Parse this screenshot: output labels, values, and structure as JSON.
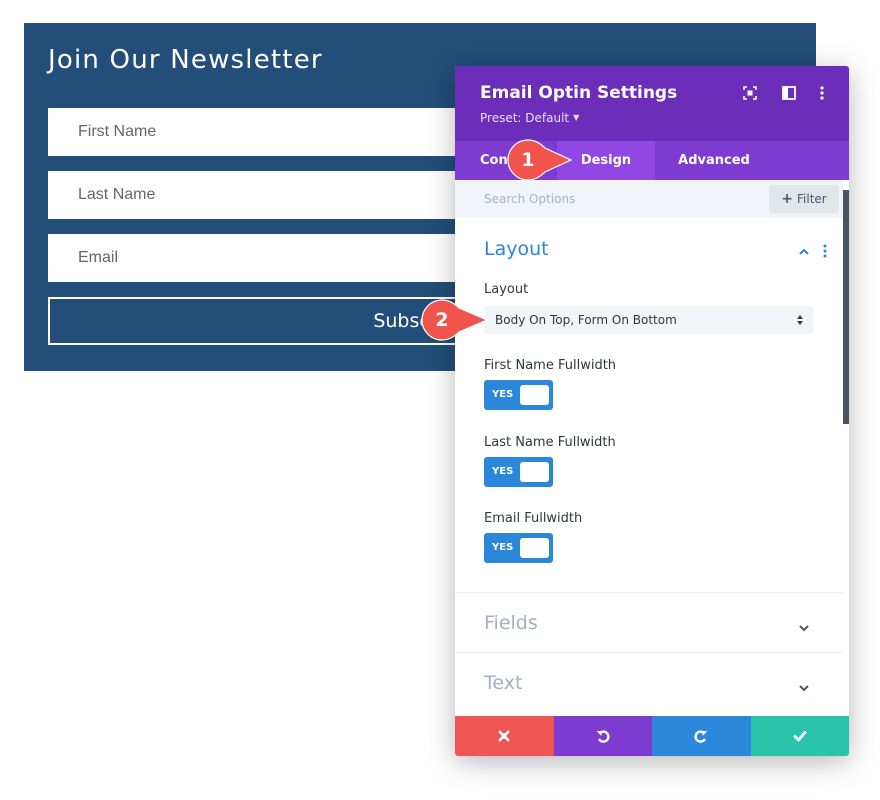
{
  "newsletter": {
    "title": "Join Our Newsletter",
    "fields": {
      "first_name": "First Name",
      "last_name": "Last Name",
      "email": "Email"
    },
    "submit_label": "Subscribe",
    "colors": {
      "background": "#234e79"
    }
  },
  "modal": {
    "title": "Email Optin Settings",
    "preset": "Preset: Default",
    "header_icons": [
      "fullscreen-icon",
      "split-view-icon",
      "more-options-icon"
    ],
    "tabs": [
      {
        "label": "Content"
      },
      {
        "label": "Design",
        "active": true
      },
      {
        "label": "Advanced"
      }
    ],
    "search": {
      "placeholder": "Search Options"
    },
    "filter_label": "Filter",
    "layout_section": {
      "title": "Layout",
      "options": {
        "layout_label": "Layout",
        "layout_value": "Body On Top, Form On Bottom",
        "first_name_fullwidth": {
          "label": "First Name Fullwidth",
          "value": "YES"
        },
        "last_name_fullwidth": {
          "label": "Last Name Fullwidth",
          "value": "YES"
        },
        "email_fullwidth": {
          "label": "Email Fullwidth",
          "value": "YES"
        }
      }
    },
    "collapsed_sections": [
      {
        "title": "Fields"
      },
      {
        "title": "Text"
      }
    ],
    "footer_buttons": [
      "cancel-icon",
      "undo-icon",
      "redo-icon",
      "save-check-icon"
    ],
    "colors": {
      "header": "#6c2eb9",
      "tabs": "#7d3bd1",
      "active_tab": "#9046e3",
      "accent_blue": "#2b87da",
      "cancel": "#ef5555",
      "undo": "#7e3bd0",
      "redo": "#2b87da",
      "save": "#29c4a9"
    }
  },
  "badges": [
    {
      "number": "1",
      "color": "#f0544c"
    },
    {
      "number": "2",
      "color": "#f0544c"
    }
  ]
}
